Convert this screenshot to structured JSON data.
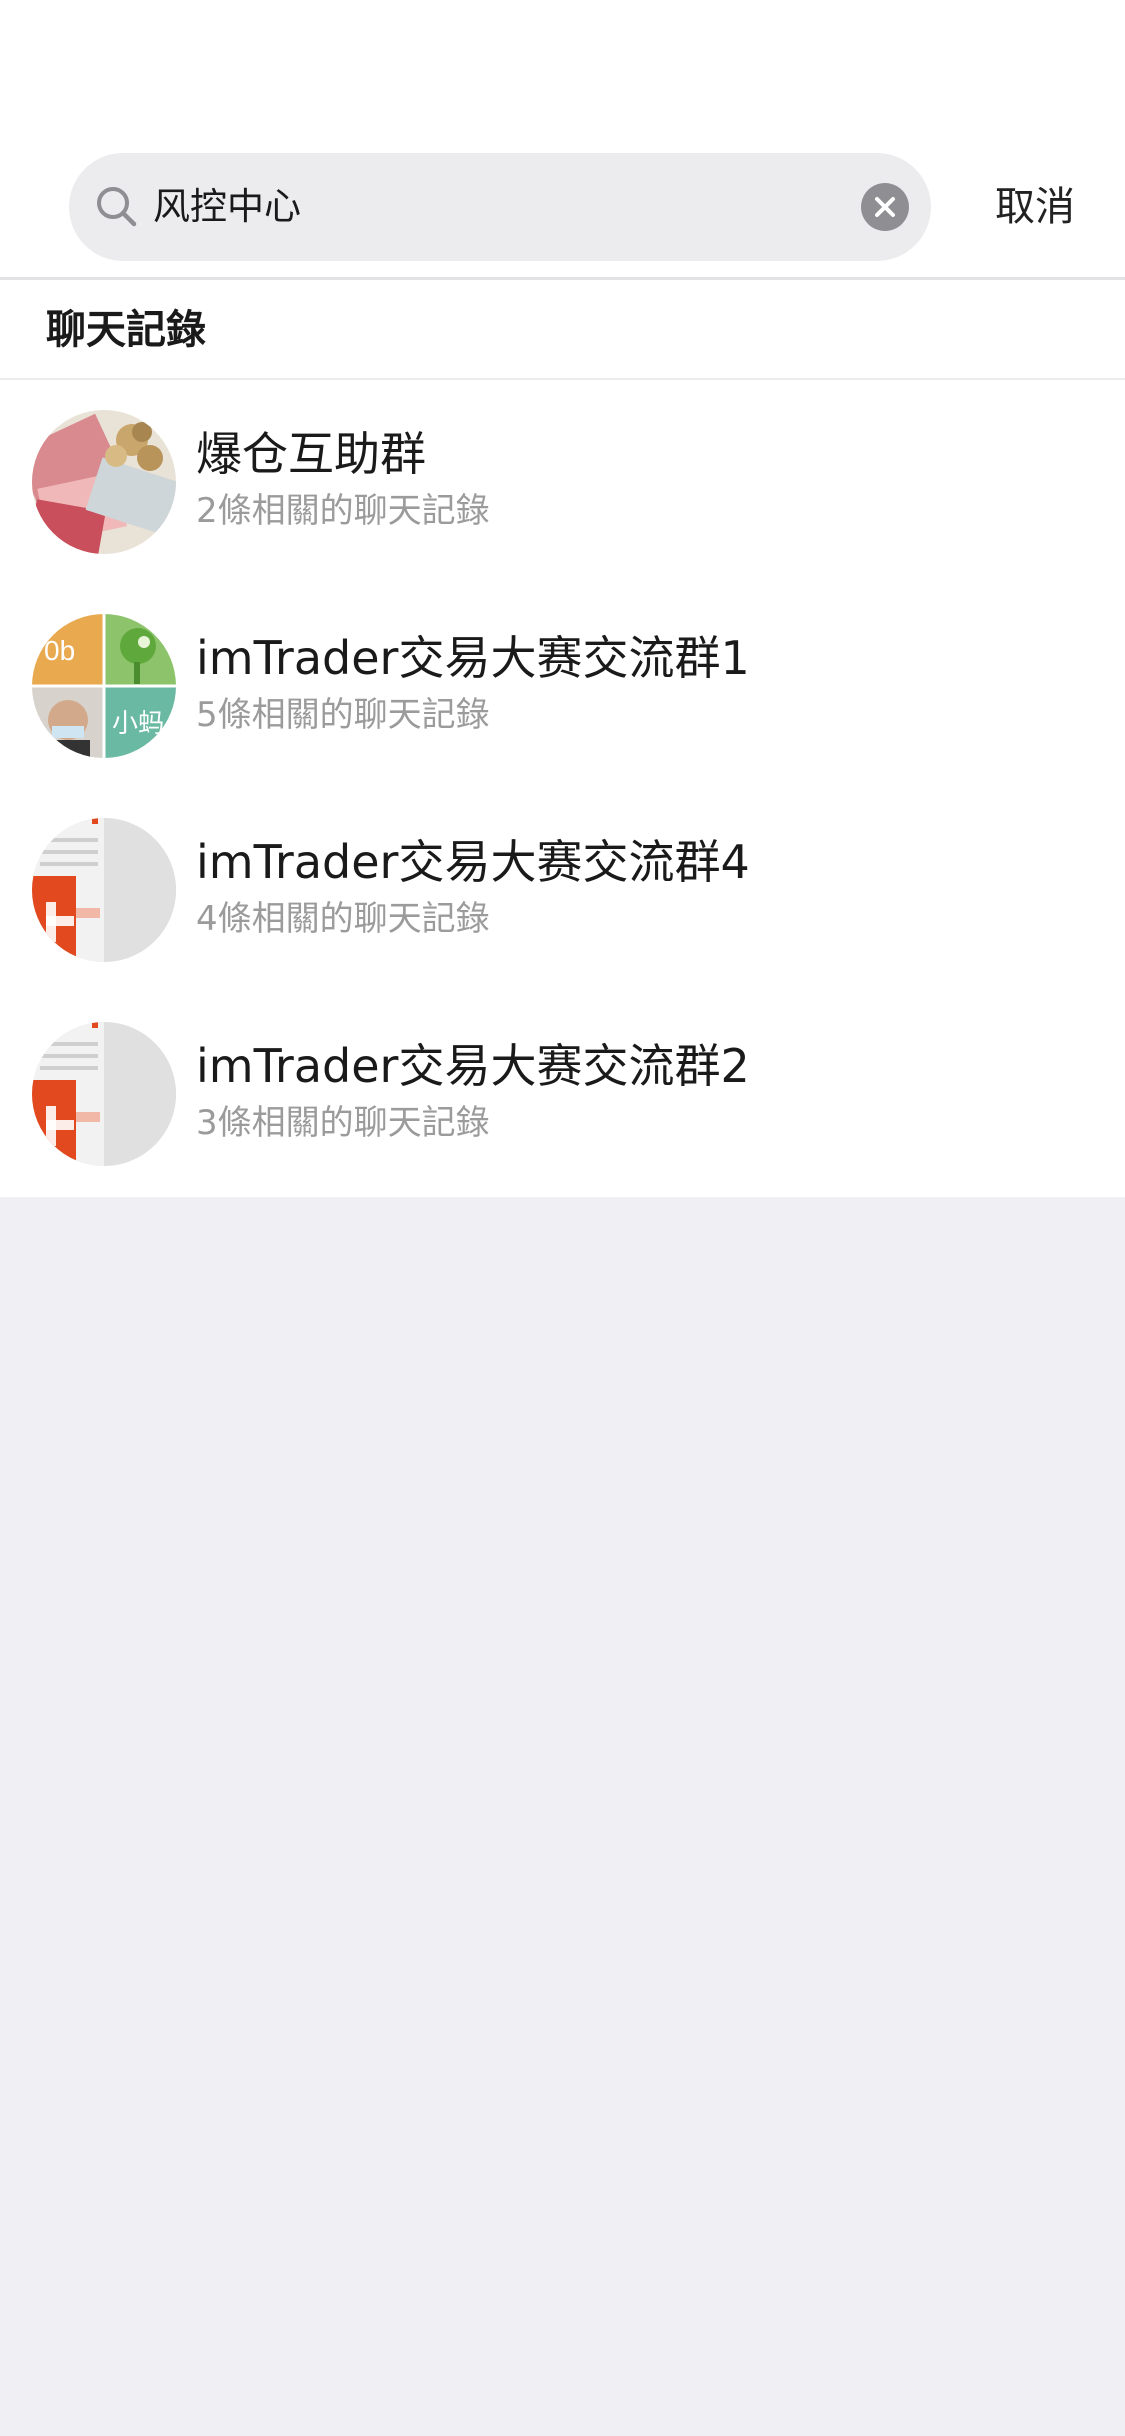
{
  "search": {
    "query": "风控中心",
    "cancel_label": "取消"
  },
  "section": {
    "title": "聊天記錄"
  },
  "results": [
    {
      "title": "爆仓互助群",
      "subtitle": "2條相關的聊天記錄",
      "avatar": "money-collage"
    },
    {
      "title": "imTrader交易大赛交流群1",
      "subtitle": "5條相關的聊天記錄",
      "avatar": "group-grid",
      "avatar_text": [
        "0b",
        "小蚂"
      ]
    },
    {
      "title": "imTrader交易大赛交流群4",
      "subtitle": "4條相關的聊天記錄",
      "avatar": "orange-document"
    },
    {
      "title": "imTrader交易大赛交流群2",
      "subtitle": "3條相關的聊天記錄",
      "avatar": "orange-document"
    }
  ],
  "colors": {
    "background": "#efeff4",
    "search_field": "#ececef",
    "subtitle": "#9b9b9b",
    "title": "#1a1a1a"
  }
}
